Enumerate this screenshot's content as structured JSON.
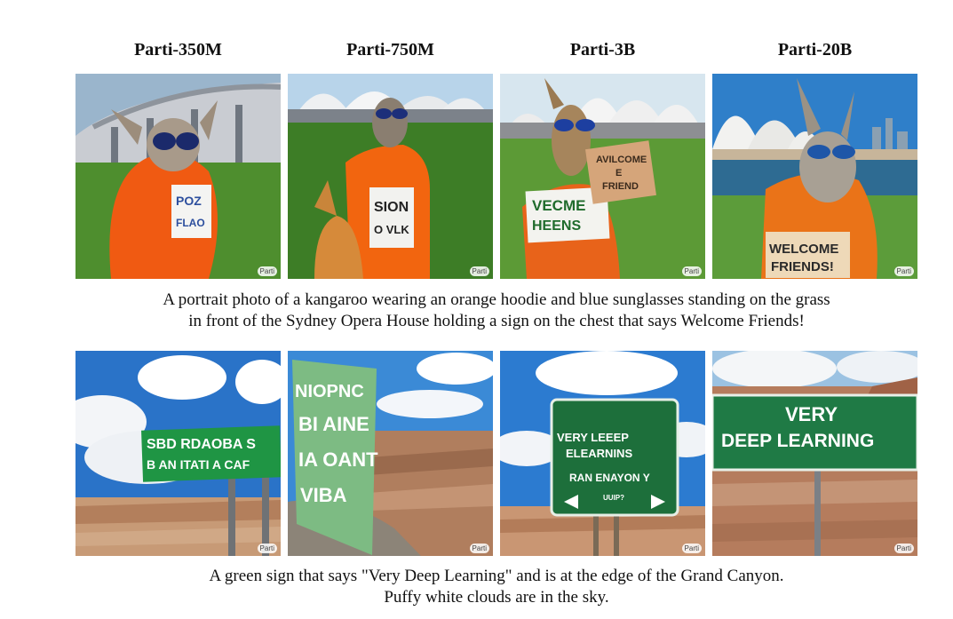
{
  "columns": [
    "Parti-350M",
    "Parti-750M",
    "Parti-3B",
    "Parti-20B"
  ],
  "watermark": "Parti",
  "rows": [
    {
      "caption_lines": [
        "A portrait photo of a kangaroo wearing an orange hoodie and blue sunglasses standing on the grass",
        "in front of the Sydney Opera House holding a sign on the chest that says Welcome Friends!"
      ],
      "sign_texts": [
        [
          "POZ",
          "FLAO"
        ],
        [
          "SION",
          "O VLK"
        ],
        [
          "VECME",
          "HEENS",
          "AVILCOME",
          "E",
          "FRIEND"
        ],
        [
          "WELCOME",
          "FRIENDS!"
        ]
      ]
    },
    {
      "caption_lines": [
        "A green sign that says \"Very Deep Learning\" and is at the edge of the Grand Canyon.",
        "Puffy white clouds are in the sky."
      ],
      "sign_texts": [
        [
          "SBD RDAOBA S",
          "B AN ITATI A CAF"
        ],
        [
          "NIOPNC",
          "BI AINE",
          "IA OANT",
          "VIBA"
        ],
        [
          "VERY LEEEP",
          "ELEARNINS",
          "RAN ENAYON Y",
          "UUIP?"
        ],
        [
          "VERY",
          "DEEP LEARNING"
        ]
      ]
    }
  ]
}
